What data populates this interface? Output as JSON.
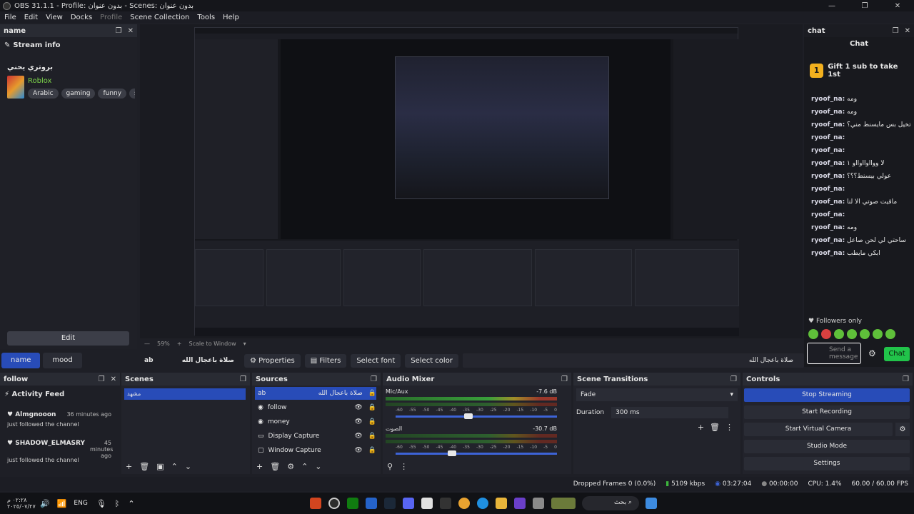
{
  "window": {
    "title": "OBS 31.1.1 - Profile: بدون عنوان - Scenes: بدون عنوان",
    "controls": [
      "—",
      "❐",
      "✕"
    ]
  },
  "menu": [
    "File",
    "Edit",
    "View",
    "Docks",
    "Profile",
    "Scene Collection",
    "Tools",
    "Help"
  ],
  "left_dock": {
    "header": "name",
    "title": "Stream info",
    "channel": "بروتري يحني",
    "game": "Roblox",
    "tags": [
      "Arabic",
      "gaming",
      "funny",
      "sole"
    ],
    "edit_label": "Edit"
  },
  "preview": {
    "zoom": "59%",
    "scale_mode": "Scale to Window"
  },
  "chat": {
    "header": "chat",
    "title": "Chat",
    "gift_badge": "1",
    "gift_text": "Gift 1 sub to take 1st",
    "messages": [
      {
        "user": "ryoof_na:",
        "text": "ومه"
      },
      {
        "user": "ryoof_na:",
        "text": "ومه"
      },
      {
        "user": "ryoof_na:",
        "text": "تخيل بس مايسنط مني؟"
      },
      {
        "user": "ryoof_na:",
        "text": ""
      },
      {
        "user": "ryoof_na:",
        "text": ""
      },
      {
        "user": "ryoof_na:",
        "text": "لا ووااوااوااو ١"
      },
      {
        "user": "ryoof_na:",
        "text": "عولي بيسنط؟؟؟"
      },
      {
        "user": "ryoof_na:",
        "text": ""
      },
      {
        "user": "ryoof_na:",
        "text": "ماقيت صوتي الا لنا"
      },
      {
        "user": "ryoof_na:",
        "text": ""
      },
      {
        "user": "ryoof_na:",
        "text": "ومه"
      },
      {
        "user": "ryoof_na:",
        "text": "ساحتي لي لحن صاعل"
      },
      {
        "user": "ryoof_na:",
        "text": "ابكي مايطب"
      }
    ],
    "followers_only": "Followers only",
    "input_placeholder": "Send a message",
    "send_label": "Chat"
  },
  "tabs": [
    "name",
    "mood"
  ],
  "properties_bar": {
    "source_short": "ab",
    "source_name": "صلاة باعجال الله",
    "buttons": [
      "Properties",
      "Filters",
      "Select font",
      "Select color"
    ],
    "text_preview": "صلاة باعجال الله"
  },
  "follow_dock": {
    "header": "follow",
    "title": "Activity Feed",
    "events": [
      {
        "name": "Almgnooon",
        "time": "36 minutes ago",
        "action": "just followed the channel"
      },
      {
        "name": "SHADOW_ELMASRY",
        "time": "45 minutes ago",
        "action": "just followed the channel"
      }
    ]
  },
  "scenes": {
    "header": "Scenes",
    "items": [
      "مشهد"
    ]
  },
  "sources": {
    "header": "Sources",
    "items": [
      {
        "label": "ab",
        "extra": "صلاة باعجال الله"
      },
      {
        "label": "follow",
        "extra": ""
      },
      {
        "label": "money",
        "extra": ""
      },
      {
        "label": "Display Capture",
        "extra": ""
      },
      {
        "label": "Window Capture",
        "extra": ""
      }
    ]
  },
  "audio_mixer": {
    "header": "Audio Mixer",
    "channels": [
      {
        "name": "Mic/Aux",
        "db": "-7.6 dB",
        "level": 0.45
      },
      {
        "name": "الصوت",
        "db": "-30.7 dB",
        "level": 0.35
      }
    ],
    "scale": [
      "-60",
      "-55",
      "-50",
      "-45",
      "-40",
      "-35",
      "-30",
      "-25",
      "-20",
      "-15",
      "-10",
      "-5",
      "0"
    ]
  },
  "transitions": {
    "header": "Scene Transitions",
    "selected": "Fade",
    "duration_label": "Duration",
    "duration_value": "300 ms"
  },
  "controls": {
    "header": "Controls",
    "buttons": [
      "Stop Streaming",
      "Start Recording",
      "Start Virtual Camera",
      "Studio Mode",
      "Settings"
    ]
  },
  "status": {
    "dropped": "Dropped Frames 0 (0.0%)",
    "bitrate": "5109 kbps",
    "stream_time": "03:27:04",
    "rec_time": "00:00:00",
    "cpu": "CPU: 1.4%",
    "fps": "60.00 / 60.00 FPS"
  },
  "taskbar": {
    "clock_time": "٠٢:٢٨ م",
    "clock_date": "٢٠٢٥/٠٧/٢٧",
    "lang": "ENG",
    "search": "بحث"
  },
  "colors": {
    "accent": "#284cb8",
    "chat_green": "#21c34a",
    "game_green": "#7dd64b"
  }
}
